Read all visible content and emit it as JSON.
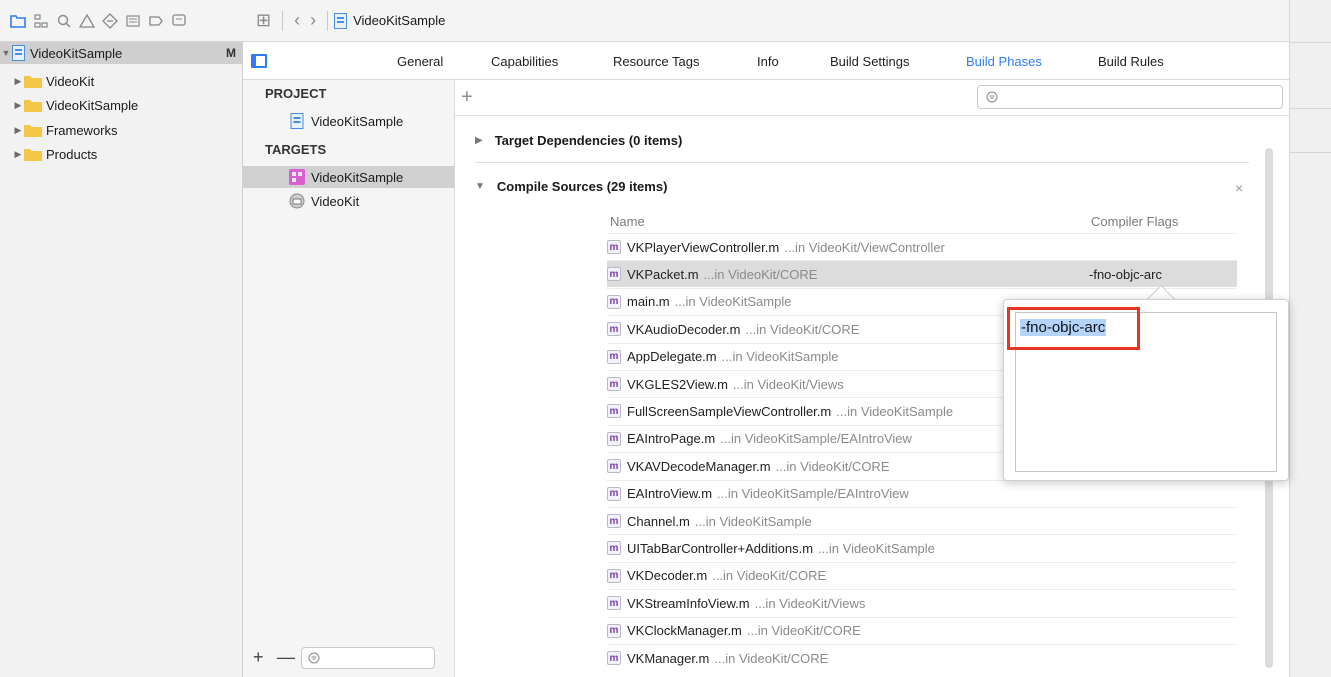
{
  "navigator": {
    "project": {
      "name": "VideoKitSample",
      "badge": "M"
    },
    "items": [
      {
        "label": "VideoKit"
      },
      {
        "label": "VideoKitSample"
      },
      {
        "label": "Frameworks"
      },
      {
        "label": "Products"
      }
    ],
    "toolbar_icons": [
      "folder-icon",
      "hierarchy-icon",
      "search-icon",
      "warning-icon",
      "test-icon",
      "debug-icon",
      "breakpoint-icon",
      "log-icon"
    ]
  },
  "jump_bar": {
    "title": "VideoKitSample"
  },
  "tabs": [
    {
      "label": "General"
    },
    {
      "label": "Capabilities"
    },
    {
      "label": "Resource Tags"
    },
    {
      "label": "Info"
    },
    {
      "label": "Build Settings"
    },
    {
      "label": "Build Phases",
      "active": true
    },
    {
      "label": "Build Rules"
    }
  ],
  "targets_panel": {
    "project_heading": "PROJECT",
    "project_name": "VideoKitSample",
    "targets_heading": "TARGETS",
    "targets": [
      {
        "label": "VideoKitSample"
      },
      {
        "label": "VideoKit"
      }
    ],
    "add_label": "+",
    "remove_label": "—"
  },
  "phases": {
    "add_label": "+",
    "target_dependencies": "Target Dependencies (0 items)",
    "compile_sources": "Compile Sources (29 items)",
    "close_label": "×",
    "col_name": "Name",
    "col_flags": "Compiler Flags",
    "files": [
      {
        "name": "VKPlayerViewController.m",
        "path": "...in VideoKit/ViewController",
        "flags": ""
      },
      {
        "name": "VKPacket.m",
        "path": "...in VideoKit/CORE",
        "flags": "-fno-objc-arc"
      },
      {
        "name": "main.m",
        "path": "...in VideoKitSample",
        "flags": ""
      },
      {
        "name": "VKAudioDecoder.m",
        "path": "...in VideoKit/CORE",
        "flags": ""
      },
      {
        "name": "AppDelegate.m",
        "path": "...in VideoKitSample",
        "flags": ""
      },
      {
        "name": "VKGLES2View.m",
        "path": "...in VideoKit/Views",
        "flags": ""
      },
      {
        "name": "FullScreenSampleViewController.m",
        "path": "...in VideoKitSample",
        "flags": ""
      },
      {
        "name": "EAIntroPage.m",
        "path": "...in VideoKitSample/EAIntroView",
        "flags": ""
      },
      {
        "name": "VKAVDecodeManager.m",
        "path": "...in VideoKit/CORE",
        "flags": ""
      },
      {
        "name": "EAIntroView.m",
        "path": "...in VideoKitSample/EAIntroView",
        "flags": ""
      },
      {
        "name": "Channel.m",
        "path": "...in VideoKitSample",
        "flags": ""
      },
      {
        "name": "UITabBarController+Additions.m",
        "path": "...in VideoKitSample",
        "flags": ""
      },
      {
        "name": "VKDecoder.m",
        "path": "...in VideoKit/CORE",
        "flags": ""
      },
      {
        "name": "VKStreamInfoView.m",
        "path": "...in VideoKit/Views",
        "flags": ""
      },
      {
        "name": "VKClockManager.m",
        "path": "...in VideoKit/CORE",
        "flags": ""
      },
      {
        "name": "VKManager.m",
        "path": "...in VideoKit/CORE",
        "flags": ""
      }
    ]
  },
  "popover": {
    "flag_value": "-fno-objc-arc"
  },
  "colors": {
    "accent": "#2f7cf6",
    "highlight_box": "#e8351f",
    "selection": "#b3d3fb"
  }
}
